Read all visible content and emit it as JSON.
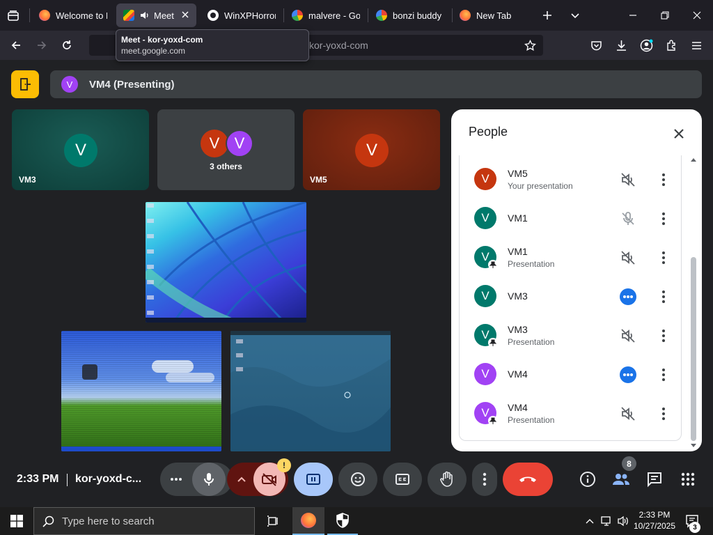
{
  "browser": {
    "tabs": [
      {
        "title": "Welcome to Fi",
        "active": false,
        "favicon": "firefox-icon"
      },
      {
        "title": "Meet",
        "active": true,
        "favicon": "google-meet-icon"
      },
      {
        "title": "WinXPHorrorE",
        "active": false,
        "favicon": "github-icon"
      },
      {
        "title": "malvere - Goo",
        "active": false,
        "favicon": "google-icon"
      },
      {
        "title": "bonzi buddy d",
        "active": false,
        "favicon": "google-icon"
      },
      {
        "title": "New Tab",
        "active": false,
        "favicon": "firefox-icon"
      }
    ],
    "url_text": "kor-yoxd-com",
    "tooltip": {
      "title": "Meet - kor-yoxd-com",
      "domain": "meet.google.com"
    }
  },
  "meet": {
    "presenting_label": "VM4 (Presenting)",
    "presenting_initial": "V",
    "tiles": [
      {
        "name": "VM3",
        "initial": "V",
        "color": "#00796b"
      },
      {
        "name": "3 others",
        "initials": [
          "V",
          "V"
        ],
        "colors": [
          "#c5360f",
          "#a142f4"
        ]
      },
      {
        "name": "VM5",
        "initial": "V",
        "color": "#c5360f"
      }
    ]
  },
  "people_panel": {
    "title": "People",
    "participants": [
      {
        "name": "VM5",
        "subtitle": "Your presentation",
        "initial": "V",
        "color": "#c5360f",
        "state": "muted",
        "pinned": false
      },
      {
        "name": "VM1",
        "subtitle": "",
        "initial": "V",
        "color": "#00796b",
        "state": "mic-off",
        "pinned": false
      },
      {
        "name": "VM1",
        "subtitle": "Presentation",
        "initial": "V",
        "color": "#00796b",
        "state": "muted",
        "pinned": true
      },
      {
        "name": "VM3",
        "subtitle": "",
        "initial": "V",
        "color": "#00796b",
        "state": "speaking",
        "pinned": false
      },
      {
        "name": "VM3",
        "subtitle": "Presentation",
        "initial": "V",
        "color": "#00796b",
        "state": "muted",
        "pinned": true
      },
      {
        "name": "VM4",
        "subtitle": "",
        "initial": "V",
        "color": "#a142f4",
        "state": "speaking",
        "pinned": false
      },
      {
        "name": "VM4",
        "subtitle": "Presentation",
        "initial": "V",
        "color": "#a142f4",
        "state": "muted",
        "pinned": true
      }
    ]
  },
  "controls": {
    "time": "2:33 PM",
    "meeting_code": "kor-yoxd-c...",
    "camera_warning": "!",
    "people_count": "8"
  },
  "taskbar": {
    "search_placeholder": "Type here to search",
    "time": "2:33 PM",
    "date": "10/27/2025",
    "notification_count": "3"
  },
  "colors": {
    "accent_blue": "#1a73e8",
    "end_call_red": "#ea4335",
    "exit_yellow": "#fbbc04",
    "present_button": "#a8c7fa"
  }
}
